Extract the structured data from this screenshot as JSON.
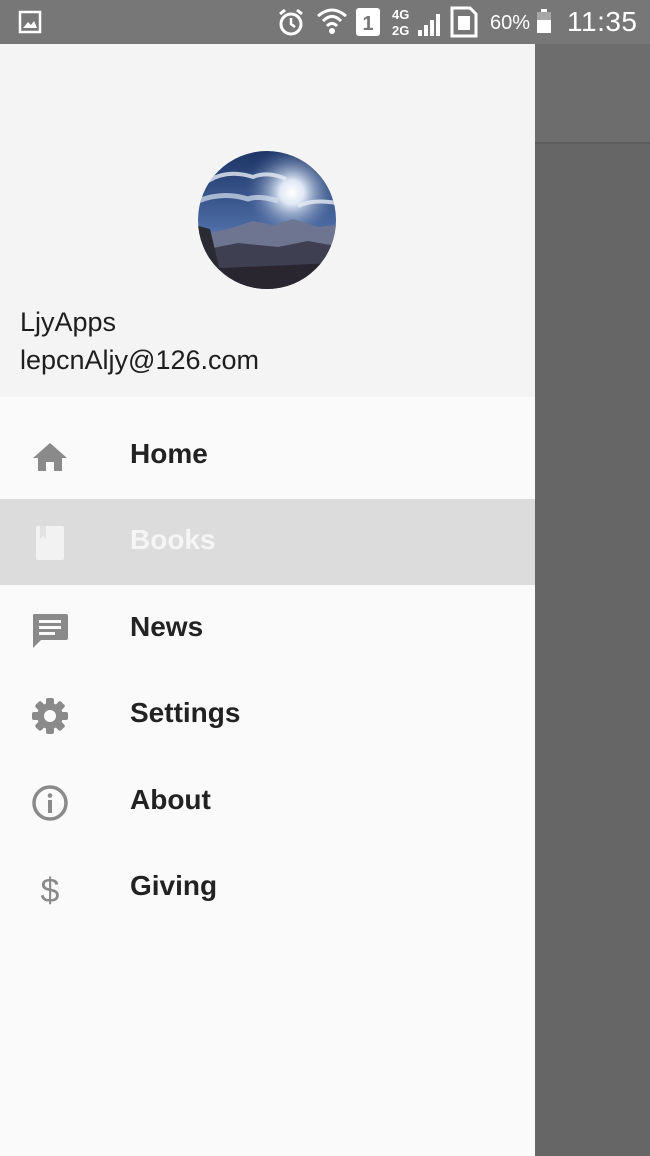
{
  "status_bar": {
    "network_top": "4G",
    "network_bottom": "2G",
    "sim": "1",
    "battery": "60%",
    "time": "11:35"
  },
  "header": {
    "name": "LjyApps",
    "email": "lepcnAljy@126.com"
  },
  "menu": [
    {
      "label": "Home",
      "icon": "home-icon",
      "selected": false
    },
    {
      "label": "Books",
      "icon": "book-icon",
      "selected": true
    },
    {
      "label": "News",
      "icon": "chat-icon",
      "selected": false
    },
    {
      "label": "Settings",
      "icon": "gear-icon",
      "selected": false
    },
    {
      "label": "About",
      "icon": "info-icon",
      "selected": false
    },
    {
      "label": "Giving",
      "icon": "dollar-icon",
      "selected": false
    }
  ],
  "colors": {
    "drawer_bg": "#fafafa",
    "header_bg": "#f4f4f4",
    "selected_bg": "#dcdcdc",
    "icon": "#8a8a8a",
    "scrim": "#666666"
  }
}
